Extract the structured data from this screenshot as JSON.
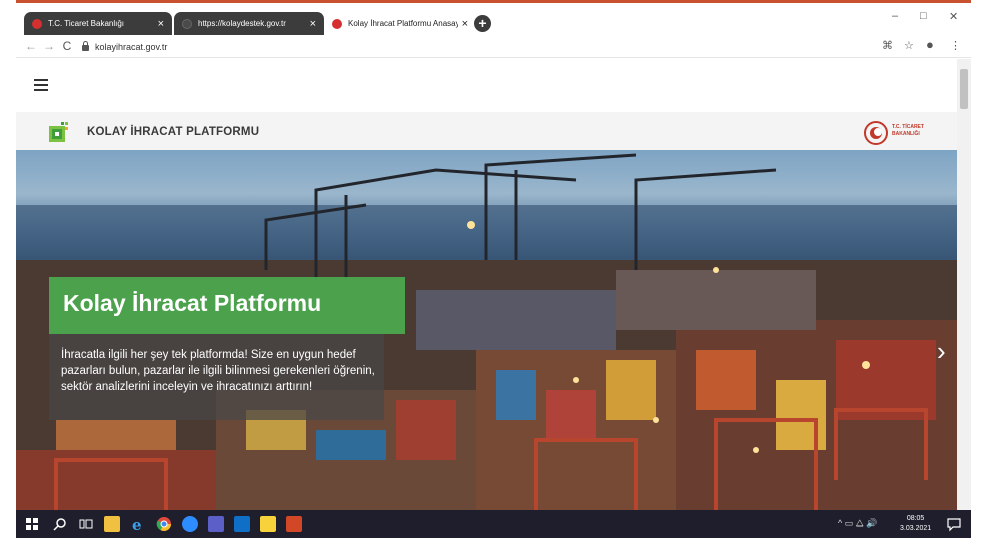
{
  "browser": {
    "tabs": [
      {
        "label": "T.C. Ticaret Bakanlığı",
        "favicon_color": "#d62f2f",
        "active": false
      },
      {
        "label": "https://kolaydestek.gov.tr",
        "favicon_color": "#4a4a4a",
        "active": false
      },
      {
        "label": "Kolay İhracat Platformu Anasayfa",
        "favicon_color": "#d62f2f",
        "active": true
      }
    ],
    "tab_close": "×",
    "new_tab": "+",
    "window_controls": {
      "minimize": "–",
      "maximize": "□",
      "close": "✕"
    },
    "nav": {
      "back": "←",
      "forward": "→",
      "reload": "C"
    },
    "url": "kolayihracat.gov.tr",
    "address_icons": {
      "keyboard": "⌘",
      "star": "☆",
      "account": "●",
      "menu": "⋮"
    }
  },
  "site": {
    "brand_title": "KOLAY İHRACAT PLATFORMU",
    "ministry_logo_text_1": "T.C. TİCARET",
    "ministry_logo_text_2": "BAKANLIĞI",
    "hero": {
      "title": "Kolay İhracat Platformu",
      "description": "İhracatla ilgili her şey tek platformda! Size en uygun hedef pazarları bulun, pazarlar ile ilgili bilinmesi gerekenleri öğrenin, sektör analizlerini inceleyin ve ihracatınızı arttırın!",
      "next_arrow": "›"
    }
  },
  "taskbar": {
    "time": "08:05",
    "date": "3.03.2021",
    "tray": "^ ▭ ⧋ 🔊"
  },
  "colors": {
    "accent_green": "#4caf50",
    "brand_red": "#c0392b",
    "taskbar": "#1e1e2c"
  }
}
